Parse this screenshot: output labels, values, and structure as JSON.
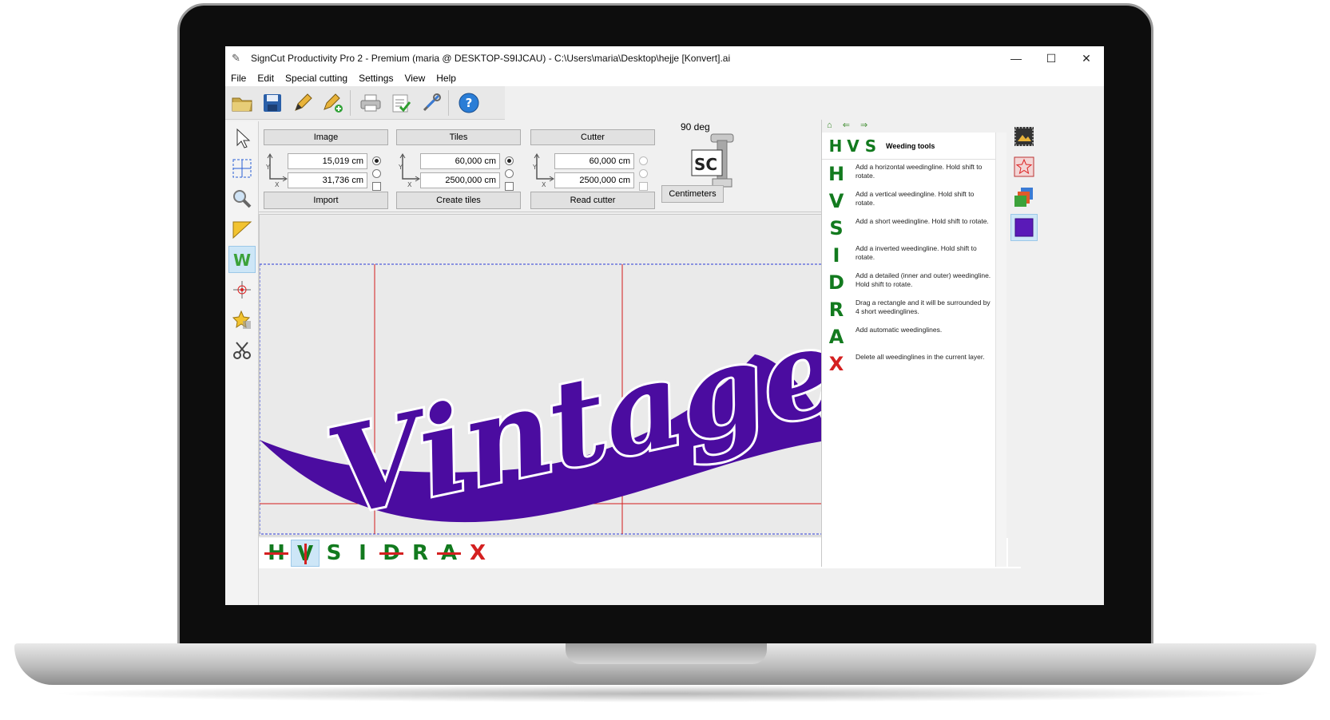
{
  "window": {
    "title": "SignCut Productivity Pro 2 - Premium (maria @ DESKTOP-S9IJCAU)  - C:\\Users\\maria\\Desktop\\hejje [Konvert].ai",
    "minimize": "—",
    "maximize": "☐",
    "close": "✕"
  },
  "menu": [
    "File",
    "Edit",
    "Special cutting",
    "Settings",
    "View",
    "Help"
  ],
  "groups": {
    "image": {
      "label": "Image",
      "x_value": "15,019 cm",
      "y_value": "31,736 cm",
      "action": "Import"
    },
    "tiles": {
      "label": "Tiles",
      "x_value": "60,000 cm",
      "y_value": "2500,000 cm",
      "action": "Create tiles"
    },
    "cutter": {
      "label": "Cutter",
      "x_value": "60,000 cm",
      "y_value": "2500,000 cm",
      "action": "Read cutter"
    }
  },
  "rotation": "90 deg",
  "logo_text": "SC",
  "units_button": "Centimeters",
  "canvas_text": "Vintage",
  "weeding": {
    "title": "Weeding tools",
    "header_letters": [
      "H",
      "V",
      "S"
    ],
    "tools": [
      {
        "letter": "H",
        "desc": "Add a horizontal weedingline. Hold shift to rotate."
      },
      {
        "letter": "V",
        "desc": "Add a vertical weedingline. Hold shift to rotate."
      },
      {
        "letter": "S",
        "desc": "Add a short weedingline. Hold shift to rotate."
      },
      {
        "letter": "I",
        "desc": "Add a inverted weedingline. Hold shift to rotate."
      },
      {
        "letter": "D",
        "desc": "Add a detailed (inner and outer) weedingline. Hold shift to rotate."
      },
      {
        "letter": "R",
        "desc": "Drag a rectangle and it will be surrounded by 4 short weedinglines."
      },
      {
        "letter": "A",
        "desc": "Add automatic weedinglines."
      },
      {
        "letter": "X",
        "desc": "Delete all weedinglines in the current layer."
      }
    ]
  },
  "bottom_tools": [
    "H",
    "V",
    "S",
    "I",
    "D",
    "R",
    "A",
    "X"
  ],
  "colors": {
    "accent_purple": "#4b0ca0",
    "weed_green": "#127a1e",
    "weed_red": "#d42020",
    "selection_blue": "#cde6f7"
  }
}
